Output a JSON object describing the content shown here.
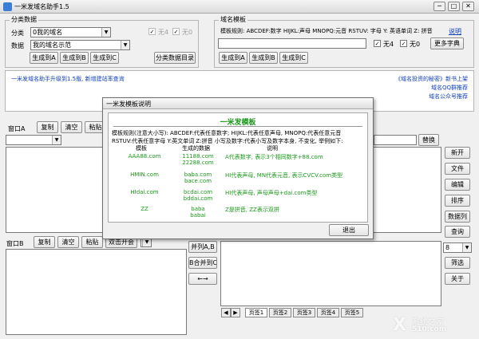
{
  "window": {
    "title": "一米发域名助手1.5",
    "min": "─",
    "max": "□",
    "close": "✕"
  },
  "categories": {
    "group_label": "分类数据",
    "category_label": "分类",
    "category_value": "0我的域名",
    "data_label": "数据",
    "data_value": "我的域名示范",
    "chk_none4": "无4",
    "chk_none0": "无0",
    "btn_gen_a": "生成到A",
    "btn_gen_b": "生成到B",
    "btn_gen_c": "生成到C",
    "btn_dir": "分类数据目录"
  },
  "template": {
    "group_label": "域名模板",
    "rule_text": "模板规则: ABCDEF:数字 HIJKL:声母 MNOPQ:元音 RSTUV: 字母 Y: 英语单词 Z: 拼音",
    "rule_link": "说明",
    "btn_gen_a": "生成到A",
    "btn_gen_b": "生成到B",
    "btn_gen_c": "生成到C",
    "chk_none4": "无4",
    "chk_none0": "无0",
    "btn_more": "更多字典"
  },
  "news": {
    "left": "一米发域名助手升级到1.5版, 新增建站率查询",
    "right1": "《域名投资的秘密》新书上架",
    "right2": "域名QQ群推荐",
    "right3": "域名公众号推荐"
  },
  "windowA": {
    "label": "窗口A",
    "copy": "复制",
    "clear": "清空",
    "paste": "粘贴",
    "replace": "替换"
  },
  "windowB": {
    "label": "窗口B",
    "copy": "复制",
    "clear": "清空",
    "paste": "粘贴",
    "sort": "双击开会"
  },
  "merge": {
    "ab": "并列A,B",
    "bc": "B合并到C",
    "swap": "←→"
  },
  "right_buttons": [
    "新开",
    "文件",
    "编辑",
    "排序",
    "数据列",
    "查询"
  ],
  "right_select": "8",
  "right_buttons2": [
    "筛选",
    "关于"
  ],
  "tabs": {
    "prev": "◀",
    "next": "▶",
    "items": [
      "页签1",
      "页签2",
      "页签3",
      "页签4",
      "页签5"
    ]
  },
  "dialog": {
    "title": "一米发模板说明",
    "heading": "一米发模板",
    "rules1": "模板规则(注意大小写): ABCDEF:代表任意数字; HIJKL:代表任意声母, MNOPQ:代表任意元音",
    "rules2": "RSTUV:代表任意字母 Y:英文单词 Z:拼音 小写及数字:代表小写及数字本身, 不变化, 举例如下:",
    "col_template": "模板",
    "col_generated": "生成的数据",
    "col_desc": "说明",
    "rows": [
      {
        "template": "AAA88.com",
        "data1": "11188.com",
        "data2": "22288.com",
        "desc": "A代表数字, 表示3个相同数字+88.com"
      },
      {
        "template": "HMIN.com",
        "data1": "baba.com",
        "data2": "bace.com",
        "desc": "HI代表声母, MN代表元音, 表示CVCV.com类型"
      },
      {
        "template": "HIdai.com",
        "data1": "bcdai.com",
        "data2": "bddai.com",
        "desc": "HI代表声母, 声母声母+dai.com类型"
      },
      {
        "template": "ZZ",
        "data1": "baba",
        "data2": "babai",
        "desc": "Z是拼音, ZZ表示双拼"
      }
    ],
    "exit": "退出"
  },
  "watermark": {
    "text": "系统之家",
    "sub": "510.com"
  },
  "colors": {
    "link_blue": "#1040c0",
    "green": "#1a9a1a",
    "logo_blue": "#3a7fd5"
  }
}
